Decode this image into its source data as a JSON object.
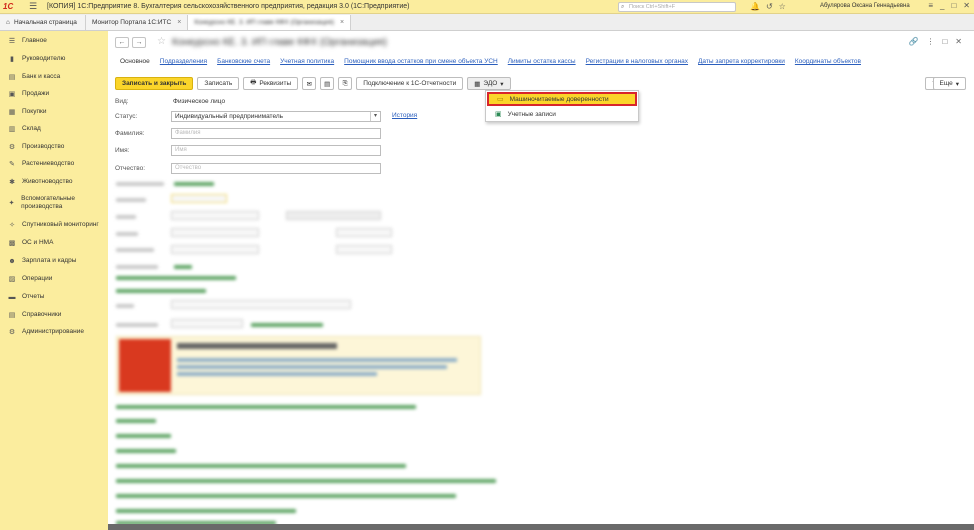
{
  "titlebar": {
    "logo": "1С",
    "app_title": "[КОПИЯ] 1С:Предприятие 8. Бухгалтерия сельскохозяйственного предприятия, редакция 3.0  (1С:Предприятие)",
    "search_placeholder": "Поиск Ctrl+Shift+F",
    "user": "Абулярова Оксана Геннадьевна"
  },
  "tabs": [
    {
      "label": "Начальная страница"
    },
    {
      "label": "Монитор Портала 1С:ИТС"
    },
    {
      "label": "Конкурсно КЕ. 3. ИП главе КФХ (Организация)"
    }
  ],
  "sidebar": {
    "items": [
      {
        "label": "Главное",
        "icon": "menu-icon"
      },
      {
        "label": "Руководителю",
        "icon": "chart-icon"
      },
      {
        "label": "Банк и касса",
        "icon": "bank-icon"
      },
      {
        "label": "Продажи",
        "icon": "cart-icon"
      },
      {
        "label": "Покупки",
        "icon": "basket-icon"
      },
      {
        "label": "Склад",
        "icon": "warehouse-icon"
      },
      {
        "label": "Производство",
        "icon": "factory-icon"
      },
      {
        "label": "Растениеводство",
        "icon": "plant-icon"
      },
      {
        "label": "Животноводство",
        "icon": "animal-icon"
      },
      {
        "label": "Вспомогательные производства",
        "icon": "auxiliary-icon"
      },
      {
        "label": "Спутниковый мониторинг",
        "icon": "satellite-icon"
      },
      {
        "label": "ОС и НМА",
        "icon": "assets-icon"
      },
      {
        "label": "Зарплата и кадры",
        "icon": "people-icon"
      },
      {
        "label": "Операции",
        "icon": "operations-icon"
      },
      {
        "label": "Отчеты",
        "icon": "reports-icon"
      },
      {
        "label": "Справочники",
        "icon": "book-icon"
      },
      {
        "label": "Администрирование",
        "icon": "gear-icon"
      }
    ]
  },
  "document": {
    "title": "Конкурсно КЕ. 3. ИП главе КФХ (Организация)",
    "subtabs": [
      "Основное",
      "Подразделения",
      "Банковские счета",
      "Учетная политика",
      "Помощник ввода остатков при смене объекта УСН",
      "Лимиты остатка кассы",
      "Регистрации в налоговых органах",
      "Даты запрета корректировки",
      "Координаты объектов"
    ]
  },
  "toolbar": {
    "save_close": "Записать и закрыть",
    "save": "Записать",
    "details": "Реквизиты",
    "connect": "Подключение к 1С-Отчетности",
    "edo": "ЭДО",
    "more": "Еще",
    "help": "?"
  },
  "edo_menu": {
    "items": [
      "Машиночитаемые доверенности",
      "Учетные записи"
    ]
  },
  "form": {
    "vid_label": "Вид:",
    "vid_value": "Физическое лицо",
    "status_label": "Статус:",
    "status_value": "Индивидуальный предприниматель",
    "history_link": "История",
    "lastname_label": "Фамилия:",
    "lastname_placeholder": "Фамилия",
    "firstname_label": "Имя:",
    "firstname_placeholder": "Имя",
    "middlename_label": "Отчество:",
    "middlename_placeholder": "Отчество"
  }
}
